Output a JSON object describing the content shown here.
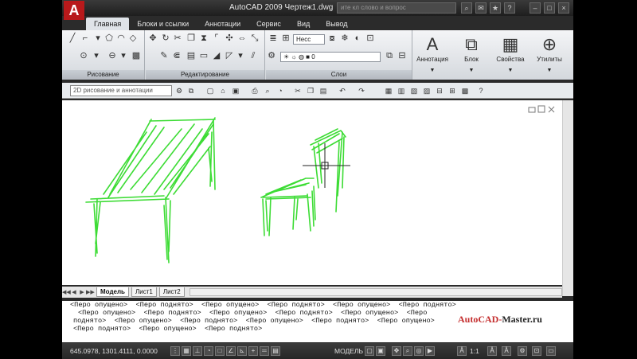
{
  "window": {
    "title": "AutoCAD 2009 Чертеж1.dwg",
    "search_placeholder": "ите кл          слово и         вопрос",
    "app_logo": "A"
  },
  "ribbon_tabs": [
    "Главная",
    "Блоки и ссылки",
    "Аннотации",
    "Сервис",
    "Вид",
    "Вывод"
  ],
  "ribbon": {
    "panels": {
      "draw": "Рисование",
      "modify": "Редактирование",
      "layers": "Слои"
    },
    "combos": {
      "layer_state": "Несс",
      "current_layer": "0"
    },
    "big_buttons": [
      {
        "label": "Аннотация",
        "glyph": "A",
        "icon": "annotation-icon"
      },
      {
        "label": "Блок",
        "glyph": "⧉",
        "icon": "block-icon"
      },
      {
        "label": "Свойства",
        "glyph": "▦",
        "icon": "properties-icon"
      },
      {
        "label": "Утилиты",
        "glyph": "⊕",
        "icon": "utilities-icon"
      }
    ]
  },
  "toolbar": {
    "workspace": "2D рисование и аннотации"
  },
  "layout_tabs": [
    "Модель",
    "Лист1",
    "Лист2"
  ],
  "command_lines": [
    "<Перо опущено>  <Перо поднято>  <Перо опущено>  <Перо поднято>  <Перо опущено>  <Перо поднято>",
    "<Перо опущено>  <Перо поднято>  <Перо опущено>  <Перо поднято>  <Перо опущено>  <Перо",
    "поднято>  <Перо опущено>  <Перо поднято>  <Перо опущено>  <Перо поднято>  <Перо опущено>",
    "<Перо поднято>  <Перо опущено>  <Перо поднято>",
    ""
  ],
  "watermark": {
    "first": "AutoCAD-",
    "rest": "Master.ru"
  },
  "status": {
    "coordinates": "645.0978, 1301.4111, 0.0000",
    "space": "МОДЕЛЬ",
    "scale": "1:1"
  },
  "colors": {
    "sketch": "#3ddc35",
    "logo": "#b8191b"
  }
}
